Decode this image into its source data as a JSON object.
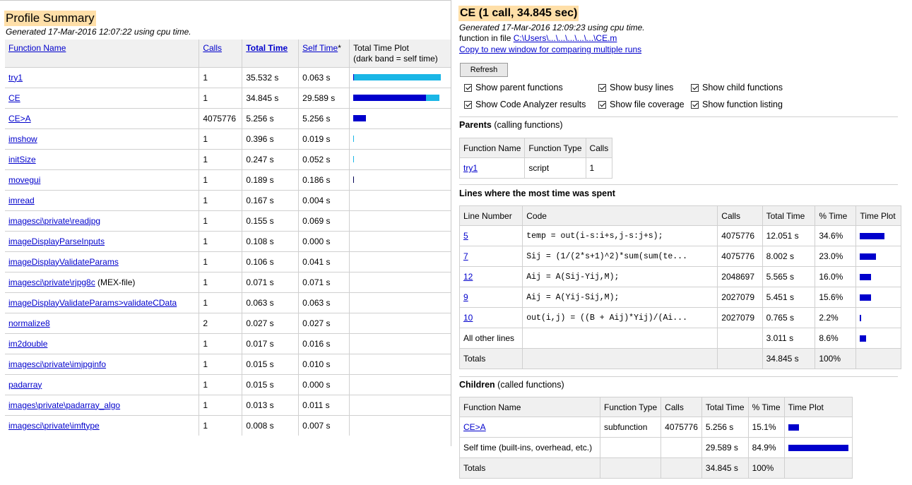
{
  "summary": {
    "title": "Profile Summary",
    "generated": "Generated 17-Mar-2016 12:07:22 using cpu time.",
    "headers": {
      "function_name": "Function Name",
      "calls": "Calls",
      "total_time": "Total Time",
      "self_time": "Self Time",
      "self_time_mark": "*",
      "plot_line1": "Total Time Plot",
      "plot_line2": "(dark band = self time)"
    },
    "rows": [
      {
        "name": "try1",
        "calls": "1",
        "total": "35.532 s",
        "self": "0.063 s",
        "total_frac": 1.0,
        "self_frac": 0.0018
      },
      {
        "name": "CE",
        "calls": "1",
        "total": "34.845 s",
        "self": "29.589 s",
        "total_frac": 0.981,
        "self_frac": 0.833
      },
      {
        "name": "CE>A",
        "calls": "4075776",
        "total": "5.256 s",
        "self": "5.256 s",
        "total_frac": 0.148,
        "self_frac": 0.148
      },
      {
        "name": "imshow",
        "calls": "1",
        "total": "0.396 s",
        "self": "0.019 s",
        "total_frac": 0.011,
        "self_frac": 0.0005
      },
      {
        "name": "initSize",
        "calls": "1",
        "total": "0.247 s",
        "self": "0.052 s",
        "total_frac": 0.007,
        "self_frac": 0.0015
      },
      {
        "name": "movegui",
        "calls": "1",
        "total": "0.189 s",
        "self": "0.186 s",
        "total_frac": 0.0053,
        "self_frac": 0.0052
      },
      {
        "name": "imread",
        "calls": "1",
        "total": "0.167 s",
        "self": "0.004 s",
        "total_frac": 0,
        "self_frac": 0
      },
      {
        "name": "imagesci\\private\\readjpg",
        "calls": "1",
        "total": "0.155 s",
        "self": "0.069 s",
        "total_frac": 0,
        "self_frac": 0
      },
      {
        "name": "imageDisplayParseInputs",
        "calls": "1",
        "total": "0.108 s",
        "self": "0.000 s",
        "total_frac": 0,
        "self_frac": 0
      },
      {
        "name": "imageDisplayValidateParams",
        "calls": "1",
        "total": "0.106 s",
        "self": "0.041 s",
        "total_frac": 0,
        "self_frac": 0
      },
      {
        "name": "imagesci\\private\\rjpg8c",
        "suffix": " (MEX-file)",
        "calls": "1",
        "total": "0.071 s",
        "self": "0.071 s",
        "total_frac": 0,
        "self_frac": 0
      },
      {
        "name": "imageDisplayValidateParams>validateCData",
        "calls": "1",
        "total": "0.063 s",
        "self": "0.063 s",
        "total_frac": 0,
        "self_frac": 0
      },
      {
        "name": "normalize8",
        "calls": "2",
        "total": "0.027 s",
        "self": "0.027 s",
        "total_frac": 0,
        "self_frac": 0
      },
      {
        "name": "im2double",
        "calls": "1",
        "total": "0.017 s",
        "self": "0.016 s",
        "total_frac": 0,
        "self_frac": 0
      },
      {
        "name": "imagesci\\private\\imjpginfo",
        "calls": "1",
        "total": "0.015 s",
        "self": "0.010 s",
        "total_frac": 0,
        "self_frac": 0
      },
      {
        "name": "padarray",
        "calls": "1",
        "total": "0.015 s",
        "self": "0.000 s",
        "total_frac": 0,
        "self_frac": 0
      },
      {
        "name": "images\\private\\padarray_algo",
        "calls": "1",
        "total": "0.013 s",
        "self": "0.011 s",
        "total_frac": 0,
        "self_frac": 0
      },
      {
        "name": "imagesci\\private\\imftype",
        "calls": "1",
        "total": "0.008 s",
        "self": "0.007 s",
        "total_frac": 0,
        "self_frac": 0
      }
    ]
  },
  "detail": {
    "title": "CE (1 call, 34.845 sec)",
    "generated": "Generated 17-Mar-2016 12:09:23 using cpu time.",
    "file_prefix": "function in file ",
    "file_path": "C:\\Users\\...\\...\\...\\...\\...\\CE.m",
    "copy_link": "Copy to new window for comparing multiple runs",
    "refresh_label": "Refresh",
    "options": [
      {
        "label": "Show parent functions",
        "checked": true
      },
      {
        "label": "Show busy lines",
        "checked": true
      },
      {
        "label": "Show child functions",
        "checked": true
      },
      {
        "label": "Show Code Analyzer results",
        "checked": true
      },
      {
        "label": "Show file coverage",
        "checked": true
      },
      {
        "label": "Show function listing",
        "checked": true
      }
    ],
    "parents": {
      "heading": "Parents",
      "subheading": " (calling functions)",
      "headers": [
        "Function Name",
        "Function Type",
        "Calls"
      ],
      "rows": [
        {
          "name": "try1",
          "type": "script",
          "calls": "1"
        }
      ]
    },
    "busy_lines": {
      "heading": "Lines where the most time was spent",
      "headers": [
        "Line Number",
        "Code",
        "Calls",
        "Total Time",
        "% Time",
        "Time Plot"
      ],
      "rows": [
        {
          "line": "5",
          "code": "temp = out(i-s:i+s,j-s:j+s);",
          "calls": "4075776",
          "total": "12.051 s",
          "pct": "34.6%",
          "frac": 0.346
        },
        {
          "line": "7",
          "code": "Sij = (1/(2*s+1)^2)*sum(sum(te...",
          "calls": "4075776",
          "total": "8.002 s",
          "pct": "23.0%",
          "frac": 0.23
        },
        {
          "line": "12",
          "code": "Aij = A(Sij-Yij,M);",
          "calls": "2048697",
          "total": "5.565 s",
          "pct": "16.0%",
          "frac": 0.16
        },
        {
          "line": "9",
          "code": "Aij = A(Yij-Sij,M);",
          "calls": "2027079",
          "total": "5.451 s",
          "pct": "15.6%",
          "frac": 0.156
        },
        {
          "line": "10",
          "code": "out(i,j) = ((B + Aij)*Yij)/(Ai...",
          "calls": "2027079",
          "total": "0.765 s",
          "pct": "2.2%",
          "frac": 0.022
        }
      ],
      "other": {
        "label": "All other lines",
        "total": "3.011 s",
        "pct": "8.6%",
        "frac": 0.086
      },
      "totals": {
        "label": "Totals",
        "total": "34.845 s",
        "pct": "100%"
      }
    },
    "children": {
      "heading": "Children",
      "subheading": " (called functions)",
      "headers": [
        "Function Name",
        "Function Type",
        "Calls",
        "Total Time",
        "% Time",
        "Time Plot"
      ],
      "rows": [
        {
          "name": "CE>A",
          "type": "subfunction",
          "calls": "4075776",
          "total": "5.256 s",
          "pct": "15.1%",
          "frac": 0.151,
          "link": true
        },
        {
          "name": "Self time (built-ins, overhead, etc.)",
          "type": "",
          "calls": "",
          "total": "29.589 s",
          "pct": "84.9%",
          "frac": 0.849,
          "link": false
        }
      ],
      "totals": {
        "label": "Totals",
        "total": "34.845 s",
        "pct": "100%"
      }
    }
  }
}
